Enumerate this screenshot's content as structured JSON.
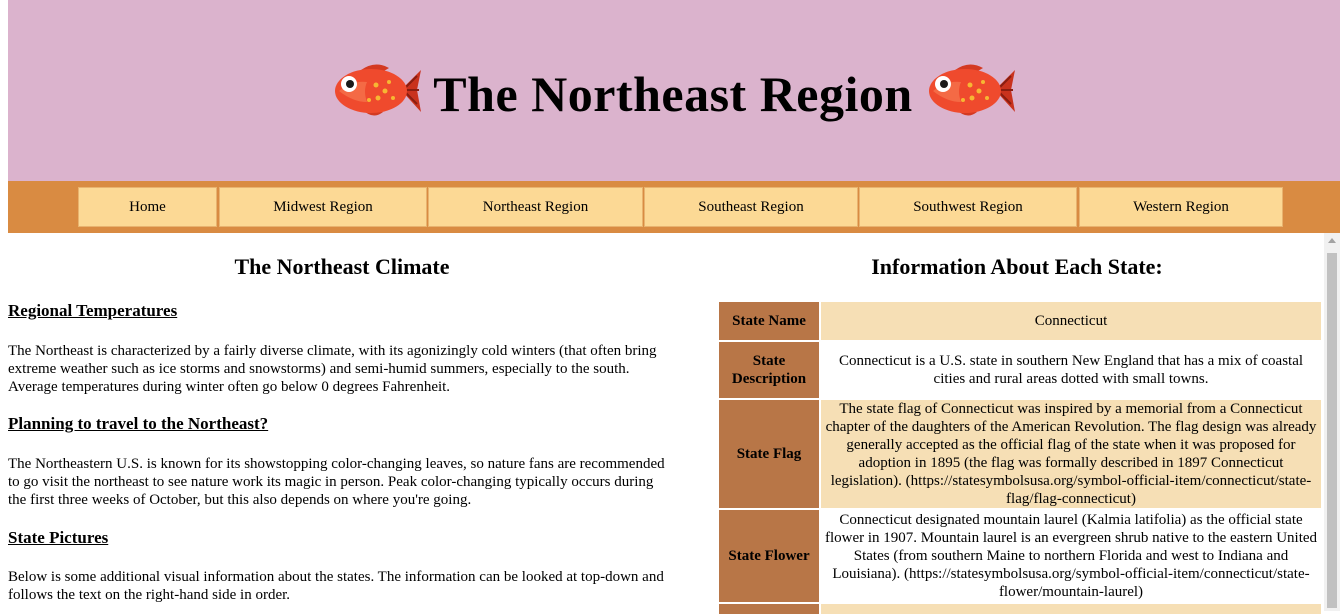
{
  "header": {
    "title": "The Northeast Region",
    "fish_icon_left": "fish-icon",
    "fish_icon_right": "fish-icon"
  },
  "nav": {
    "items": [
      {
        "label": "Home"
      },
      {
        "label": "Midwest Region"
      },
      {
        "label": "Northeast Region"
      },
      {
        "label": "Southeast Region"
      },
      {
        "label": "Southwest Region"
      },
      {
        "label": "Western Region"
      }
    ]
  },
  "climate": {
    "title": "The Northeast Climate",
    "sections": [
      {
        "heading": "Regional Temperatures",
        "text": "The Northeast is characterized by a fairly diverse climate, with its agonizingly cold winters (that often bring extreme weather such as ice storms and snowstorms) and semi-humid summers, especially to the south. Average temperatures during winter often go below 0 degrees Fahrenheit."
      },
      {
        "heading": "Planning to travel to the Northeast?",
        "text": "The Northeastern U.S. is known for its showstopping color-changing leaves, so nature fans are recommended to go visit the northeast to see nature work its magic in person. Peak color-changing typically occurs during the first three weeks of October, but this also depends on where you're going."
      },
      {
        "heading": "State Pictures",
        "text": "Below is some additional visual information about the states. The information can be looked at top-down and follows the text on the right-hand side in order."
      }
    ]
  },
  "info": {
    "title": "Information About Each State:",
    "rows": [
      {
        "label": "State Name",
        "value": "Connecticut"
      },
      {
        "label": "State Description",
        "value": "Connecticut is a U.S. state in southern New England that has a mix of coastal cities and rural areas dotted with small towns."
      },
      {
        "label": "State Flag",
        "value": "The state flag of Connecticut was inspired by a memorial from a Connecticut chapter of the daughters of the American Revolution. The flag design was already generally accepted as the official flag of the state when it was proposed for adoption in 1895 (the flag was formally described in 1897 Connecticut legislation). (https://statesymbolsusa.org/symbol-official-item/connecticut/state-flag/flag-connecticut)"
      },
      {
        "label": "State Flower",
        "value": "Connecticut designated mountain laurel (Kalmia latifolia) as the official state flower in 1907. Mountain laurel is an evergreen shrub native to the eastern United States (from southern Maine to northern Florida and west to Indiana and Louisiana). (https://statesymbolsusa.org/symbol-official-item/connecticut/state-flower/mountain-laurel)"
      }
    ]
  },
  "colors": {
    "header_bg": "#dbb3cd",
    "nav_bg": "#d98b42",
    "nav_button": "#fcd995",
    "table_header": "#b87647",
    "table_beige": "#f6dfb5"
  }
}
